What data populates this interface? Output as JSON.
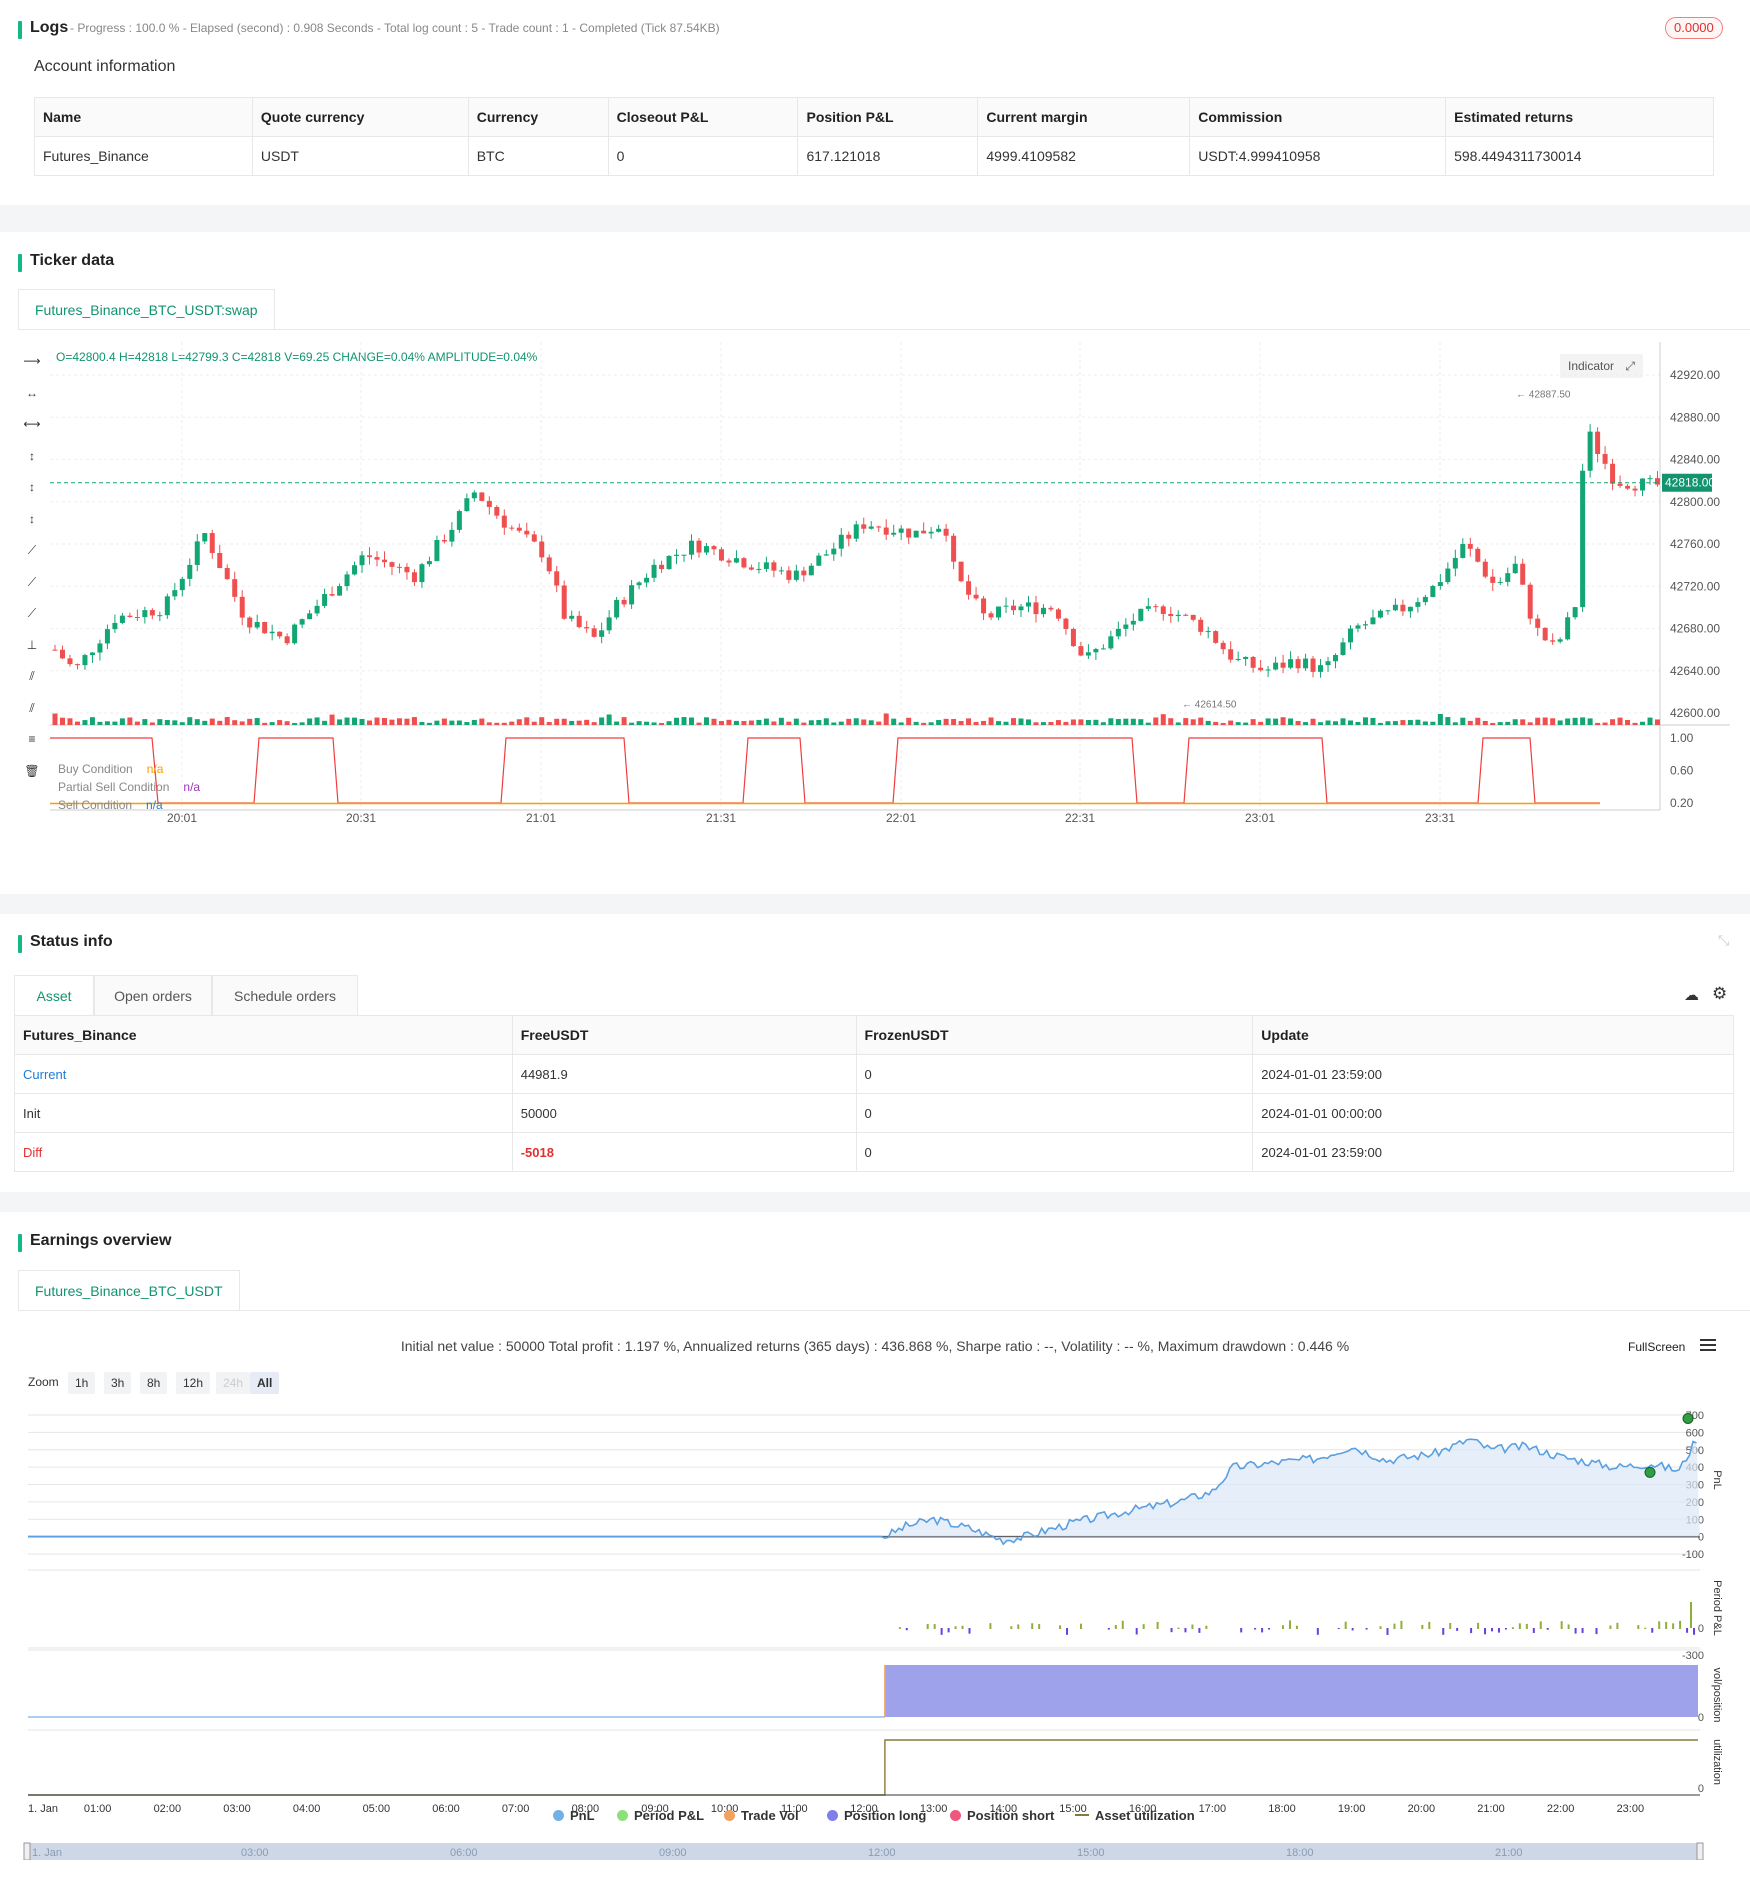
{
  "logs": {
    "title": "Logs",
    "progress_text": "- Progress : 100.0 % - Elapsed (second) : 0.908  Seconds - Total log count : 5 - Trade count : 1 - Completed (Tick 87.54KB)",
    "badge": "0.0000"
  },
  "account": {
    "title": "Account information",
    "columns": [
      "Name",
      "Quote currency",
      "Currency",
      "Closeout P&L",
      "Position P&L",
      "Current margin",
      "Commission",
      "Estimated returns"
    ],
    "row": [
      "Futures_Binance",
      "USDT",
      "BTC",
      "0",
      "617.121018",
      "4999.4109582",
      "USDT:4.999410958",
      "598.4494311730014"
    ]
  },
  "ticker": {
    "title": "Ticker data",
    "tab_label": "Futures_Binance_BTC_USDT:swap",
    "ohlc_line": "O=42800.4 H=42818 L=42799.3 C=42818 V=69.25 CHANGE=0.04% AMPLITUDE=0.04%",
    "indicator_btn": "Indicator",
    "price_ticks": [
      "42920.00",
      "42880.00",
      "42840.00",
      "42800.00",
      "42760.00",
      "42720.00",
      "42680.00",
      "42640.00",
      "42600.00"
    ],
    "current_price": "42818.00",
    "high_label": "42887.50",
    "low_label": "42614.50",
    "ind_ticks": [
      "1.00",
      "0.60",
      "0.20"
    ],
    "time_ticks": [
      "20:01",
      "20:31",
      "21:01",
      "21:31",
      "22:01",
      "22:31",
      "23:01",
      "23:31"
    ],
    "legend": [
      {
        "name": "Buy Condition",
        "value": "n/a",
        "color": "#f59f00"
      },
      {
        "name": "Partial Sell Condition",
        "value": "n/a",
        "color": "#9c36b5"
      },
      {
        "name": "Sell Condition",
        "value": "n/a",
        "color": "#1c7ed6"
      }
    ]
  },
  "status": {
    "title": "Status info",
    "tabs": [
      "Asset",
      "Open orders",
      "Schedule orders"
    ],
    "columns": [
      "Futures_Binance",
      "FreeUSDT",
      "FrozenUSDT",
      "Update"
    ],
    "rows": [
      {
        "label": "Current",
        "free": "44981.9",
        "frozen": "0",
        "update": "2024-01-01 23:59:00"
      },
      {
        "label": "Init",
        "free": "50000",
        "frozen": "0",
        "update": "2024-01-01 00:00:00"
      },
      {
        "label": "Diff",
        "free": "-5018",
        "frozen": "0",
        "update": "2024-01-01 23:59:00"
      }
    ]
  },
  "earnings": {
    "title": "Earnings overview",
    "tab_label": "Futures_Binance_BTC_USDT",
    "summary": "Initial net value : 50000 Total profit : 1.197 %, Annualized returns (365 days) : 436.868 %, Sharpe ratio : --, Volatility : -- %, Maximum drawdown : 0.446 %",
    "fullscreen": "FullScreen",
    "zoom_label": "Zoom",
    "zoom_buttons": [
      "1h",
      "3h",
      "8h",
      "12h",
      "24h",
      "All"
    ],
    "pnl_ticks": [
      "700",
      "600",
      "500",
      "400",
      "300",
      "200",
      "100",
      "0",
      "-100"
    ],
    "period_ticks": [
      "0",
      "-300"
    ],
    "axis_labels": [
      "PnL",
      "Period P&L",
      "vol/position",
      "utilization"
    ],
    "small_zero": "0",
    "time_ticks": [
      "1. Jan",
      "01:00",
      "02:00",
      "03:00",
      "04:00",
      "05:00",
      "06:00",
      "07:00",
      "08:00",
      "09:00",
      "10:00",
      "11:00",
      "12:00",
      "13:00",
      "14:00",
      "15:00",
      "16:00",
      "17:00",
      "18:00",
      "19:00",
      "20:00",
      "21:00",
      "22:00",
      "23:00"
    ],
    "nav_ticks": [
      "1. Jan",
      "03:00",
      "06:00",
      "09:00",
      "12:00",
      "15:00",
      "18:00",
      "21:00"
    ],
    "legend": [
      {
        "name": "PnL",
        "color": "#74b0e8"
      },
      {
        "name": "Period P&L",
        "color": "#8ce07a"
      },
      {
        "name": "Trade Vol",
        "color": "#f4a15d"
      },
      {
        "name": "Position long",
        "color": "#7f7fe8"
      },
      {
        "name": "Position short",
        "color": "#f0577a"
      },
      {
        "name": "Asset utilization",
        "color": "#8a7a3a"
      }
    ]
  }
}
